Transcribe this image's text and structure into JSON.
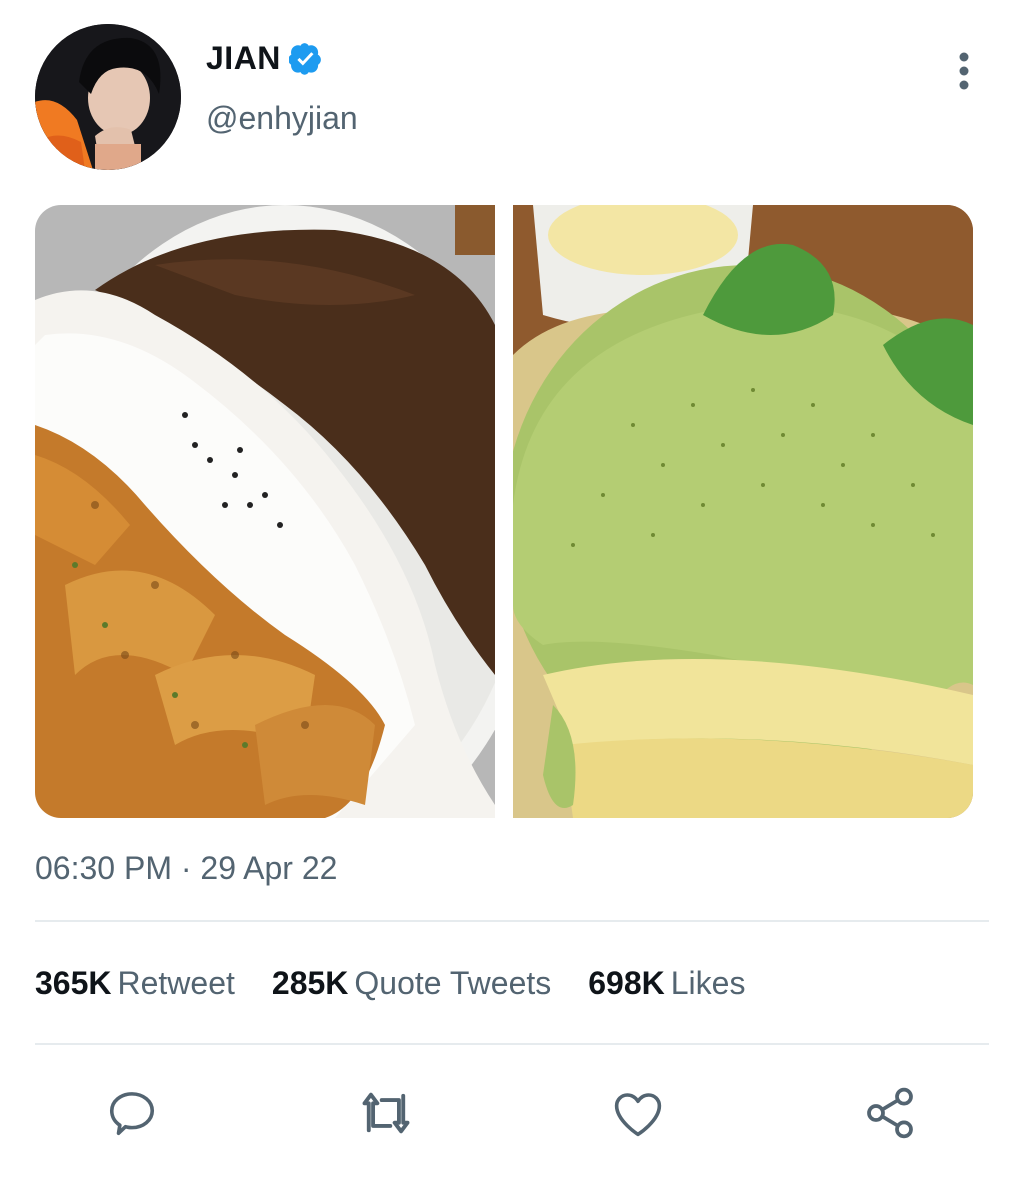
{
  "tweet": {
    "author": {
      "display_name": "JIAN",
      "handle": "@enhyjian",
      "verified": true,
      "verified_color": "#1d9bf0"
    },
    "timestamp": "06:30 PM · 29 Apr 22",
    "media": [
      {
        "name": "katsu-curry-photo"
      },
      {
        "name": "matcha-pancake-photo"
      }
    ],
    "stats": {
      "retweets": {
        "count": "365K",
        "label": "Retweet"
      },
      "quotes": {
        "count": "285K",
        "label": "Quote Tweets"
      },
      "likes": {
        "count": "698K",
        "label": "Likes"
      }
    },
    "actions": [
      "reply-icon",
      "retweet-icon",
      "like-icon",
      "share-icon"
    ]
  },
  "colors": {
    "text_primary": "#0f1419",
    "text_secondary": "#536471",
    "divider": "#e6ebee",
    "icon": "#536471"
  }
}
